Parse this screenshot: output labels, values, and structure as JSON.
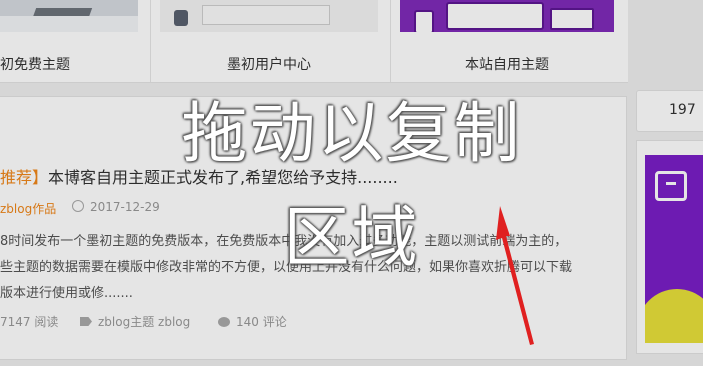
{
  "themes": [
    {
      "caption": "初免费主题"
    },
    {
      "caption": "墨初用户中心"
    },
    {
      "caption": "本站自用主题"
    }
  ],
  "sidebar": {
    "stat": "197"
  },
  "post": {
    "tag": "推荐】",
    "title": "本博客自用主题正式发布了,希望您给予支持........",
    "category": "zblog作品",
    "date": "2017-12-29",
    "excerpt": [
      "8时间发布一个墨初主题的免费版本，在免费版本中我没有加入过多功能，主题以测试前端为主的，",
      "些主题的数据需要在模版中修改非常的不方便，以便用上并没有什么问题，如果你喜欢折腾可以下载",
      "版本进行使用或修......."
    ],
    "views": "7147 阅读",
    "tags": "zblog主题 zblog",
    "comments": "140 评论"
  },
  "overlay": {
    "line1": "拖动以复制",
    "line2": "区域",
    "arrow_color": "#e02020"
  }
}
